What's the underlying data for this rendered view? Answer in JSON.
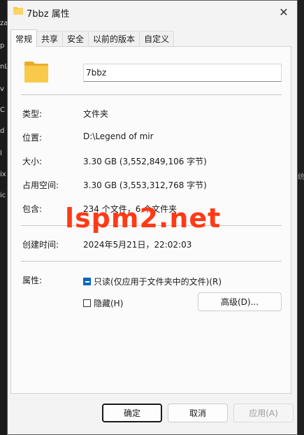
{
  "background": {
    "side_chars": [
      "za",
      "p",
      "nL",
      "v",
      "C",
      "d",
      "l",
      "ix",
      "ic"
    ],
    "right_char": "统"
  },
  "window": {
    "title": "7bbz 属性",
    "close_glyph": "✕"
  },
  "tabs": [
    {
      "label": "常规",
      "active": true
    },
    {
      "label": "共享",
      "active": false
    },
    {
      "label": "安全",
      "active": false
    },
    {
      "label": "以前的版本",
      "active": false
    },
    {
      "label": "自定义",
      "active": false
    }
  ],
  "general": {
    "name": "7bbz",
    "type_label": "类型:",
    "type_value": "文件夹",
    "location_label": "位置:",
    "location_value": "D:\\Legend of mir",
    "size_label": "大小:",
    "size_value": "3.30 GB (3,552,849,106 字节)",
    "disk_size_label": "占用空间:",
    "disk_size_value": "3.30 GB (3,553,312,768 字节)",
    "contains_label": "包含:",
    "contains_value": "234 个文件，6 个文件夹",
    "created_label": "创建时间:",
    "created_value": "2024年5月21日，22:02:03",
    "attributes_label": "属性:",
    "readonly_label": "只读(仅应用于文件夹中的文件)(R)",
    "hidden_label": "隐藏(H)",
    "advanced_label": "高级(D)..."
  },
  "footer": {
    "ok": "确定",
    "cancel": "取消",
    "apply": "应用(A)"
  },
  "watermark": "lspm2.net",
  "colors": {
    "accent": "#0067c0",
    "folder": "#f8c94b",
    "watermark": "#ff3b17"
  }
}
